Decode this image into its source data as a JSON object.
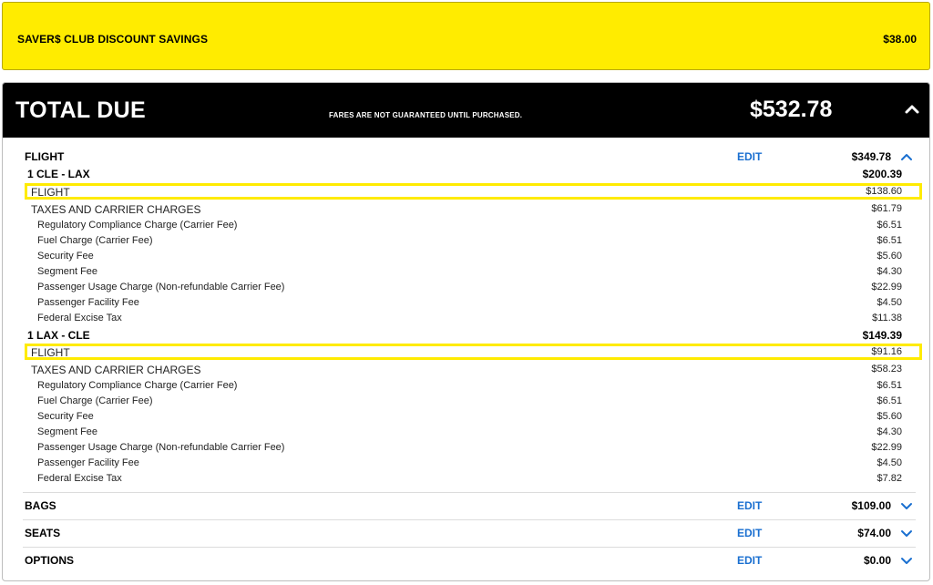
{
  "savers": {
    "label": "SAVER$ CLUB DISCOUNT SAVINGS",
    "amount": "$38.00"
  },
  "total": {
    "title": "TOTAL DUE",
    "note": "FARES ARE NOT GUARANTEED UNTIL PURCHASED.",
    "amount": "$532.78",
    "collapse_icon": "chevron-up-icon"
  },
  "flight": {
    "label": "FLIGHT",
    "edit": "EDIT",
    "amount": "$349.78",
    "legs": [
      {
        "label": "1 CLE - LAX",
        "amount": "$200.39",
        "flight_label": "FLIGHT",
        "flight_amount": "$138.60",
        "taxes_label": "TAXES AND CARRIER CHARGES",
        "taxes_amount": "$61.79",
        "fees": [
          {
            "label": "Regulatory Compliance Charge (Carrier Fee)",
            "amount": "$6.51"
          },
          {
            "label": "Fuel Charge (Carrier Fee)",
            "amount": "$6.51"
          },
          {
            "label": "Security Fee",
            "amount": "$5.60"
          },
          {
            "label": "Segment Fee",
            "amount": "$4.30"
          },
          {
            "label": "Passenger Usage Charge (Non-refundable Carrier Fee)",
            "amount": "$22.99"
          },
          {
            "label": "Passenger Facility Fee",
            "amount": "$4.50"
          },
          {
            "label": "Federal Excise Tax",
            "amount": "$11.38"
          }
        ]
      },
      {
        "label": "1 LAX - CLE",
        "amount": "$149.39",
        "flight_label": "FLIGHT",
        "flight_amount": "$91.16",
        "taxes_label": "TAXES AND CARRIER CHARGES",
        "taxes_amount": "$58.23",
        "fees": [
          {
            "label": "Regulatory Compliance Charge (Carrier Fee)",
            "amount": "$6.51"
          },
          {
            "label": "Fuel Charge (Carrier Fee)",
            "amount": "$6.51"
          },
          {
            "label": "Security Fee",
            "amount": "$5.60"
          },
          {
            "label": "Segment Fee",
            "amount": "$4.30"
          },
          {
            "label": "Passenger Usage Charge (Non-refundable Carrier Fee)",
            "amount": "$22.99"
          },
          {
            "label": "Passenger Facility Fee",
            "amount": "$4.50"
          },
          {
            "label": "Federal Excise Tax",
            "amount": "$7.82"
          }
        ]
      }
    ]
  },
  "bags": {
    "label": "BAGS",
    "edit": "EDIT",
    "amount": "$109.00"
  },
  "seats": {
    "label": "SEATS",
    "edit": "EDIT",
    "amount": "$74.00"
  },
  "options": {
    "label": "OPTIONS",
    "edit": "EDIT",
    "amount": "$0.00"
  },
  "colors": {
    "highlight": "#ffec00",
    "link": "#1a6fd0",
    "header_bg": "#000000"
  }
}
